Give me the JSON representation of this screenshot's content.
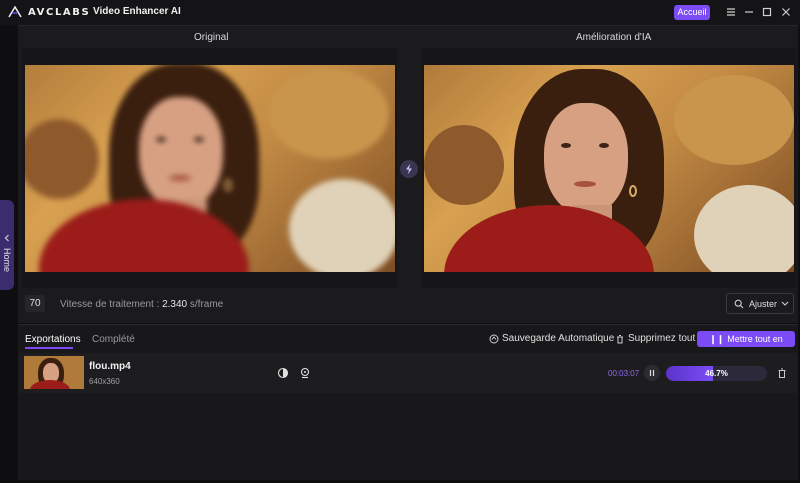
{
  "titlebar": {
    "brand": "AVCLABS",
    "app_name": "Video Enhancer AI",
    "accueil": "Accueil"
  },
  "preview": {
    "original_label": "Original",
    "enhanced_label": "Amélioration d'IA",
    "frame_number": "70",
    "speed_label": "Vitesse de traitement :",
    "speed_value": "2.340",
    "speed_unit": "s/frame",
    "fit_label": "Ajuster"
  },
  "sidebar": {
    "home_label": "Home"
  },
  "exports": {
    "tabs": [
      {
        "label": "Exportations",
        "active": true
      },
      {
        "label": "Complété",
        "active": false
      }
    ],
    "auto_save": "Sauvegarde Automatique",
    "delete_all": "Supprimez tout",
    "pause_all": "Mettre tout en pause",
    "items": [
      {
        "file_name": "flou.mp4",
        "resolution": "640x360",
        "elapsed": "00:03:07",
        "progress_text": "46.7%",
        "progress_fraction": 0.467
      }
    ]
  },
  "colors": {
    "accent": "#7b4cf5",
    "background": "#0e0e10"
  }
}
